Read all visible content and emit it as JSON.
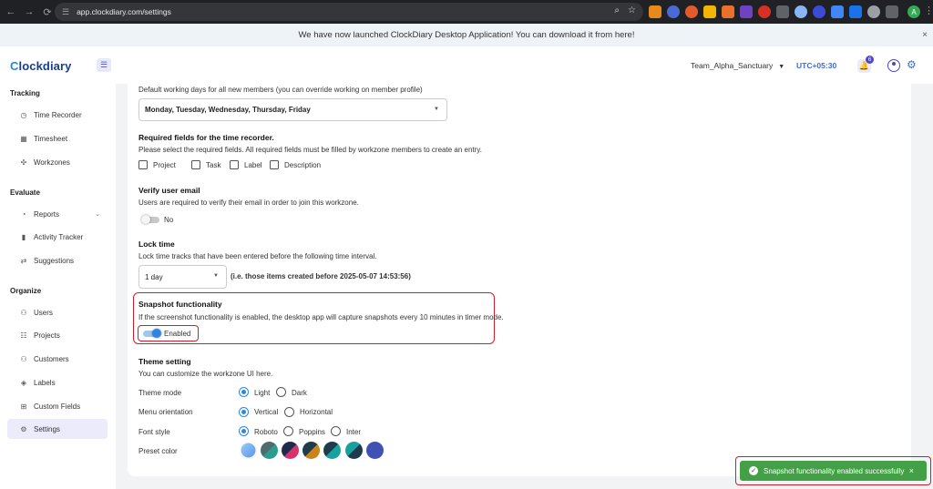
{
  "browser": {
    "url": "app.clockdiary.com/settings",
    "profile_initial": "A"
  },
  "announcement": {
    "text": "We have now launched ClockDiary Desktop Application! You can download it from here!",
    "close": "×"
  },
  "header": {
    "logo_first": "C",
    "logo_rest": "lockdiary",
    "workspace": "Team_Alpha_Sanctuary",
    "timezone": "UTC+05:30",
    "notification_count": "6"
  },
  "sidebar": {
    "sections": [
      {
        "title": "Tracking",
        "items": [
          {
            "label": "Time Recorder",
            "icon": "clock-icon"
          },
          {
            "label": "Timesheet",
            "icon": "calendar-icon"
          },
          {
            "label": "Workzones",
            "icon": "workzones-icon"
          }
        ]
      },
      {
        "title": "Evaluate",
        "items": [
          {
            "label": "Reports",
            "icon": "reports-icon"
          },
          {
            "label": "Activity Tracker",
            "icon": "activity-icon"
          },
          {
            "label": "Suggestions",
            "icon": "suggestions-icon"
          }
        ]
      },
      {
        "title": "Organize",
        "items": [
          {
            "label": "Users",
            "icon": "users-icon"
          },
          {
            "label": "Projects",
            "icon": "projects-icon"
          },
          {
            "label": "Customers",
            "icon": "customers-icon"
          },
          {
            "label": "Labels",
            "icon": "labels-icon"
          },
          {
            "label": "Custom Fields",
            "icon": "custom-fields-icon"
          },
          {
            "label": "Settings",
            "icon": "settings-icon",
            "active": true
          }
        ]
      }
    ]
  },
  "settings": {
    "working_days": {
      "description": "Default working days for all new members (you can override working on member profile)",
      "value": "Monday, Tuesday, Wednesday, Thursday, Friday"
    },
    "required_fields": {
      "title": "Required fields for the time recorder.",
      "description": "Please select the required fields. All required fields must be filled by workzone members to create an entry.",
      "options": [
        {
          "label": "Project",
          "checked": false
        },
        {
          "label": "Task",
          "checked": false
        },
        {
          "label": "Label",
          "checked": false
        },
        {
          "label": "Description",
          "checked": false
        }
      ]
    },
    "verify_email": {
      "title": "Verify user email",
      "description": "Users are required to verify their email in order to join this workzone.",
      "toggle_label": "No",
      "on": false
    },
    "lock_time": {
      "title": "Lock time",
      "description": "Lock time tracks that have been entered before the following time interval.",
      "value": "1 day",
      "note": "(i.e. those items created before 2025-05-07 14:53:56)"
    },
    "snapshot": {
      "title": "Snapshot functionality",
      "description": "If the screenshot functionality is enabled, the desktop app will capture snapshots every 10 minutes in timer mode.",
      "toggle_label": "Enabled",
      "on": true
    },
    "theme": {
      "title": "Theme setting",
      "description": "You can customize the workzone UI here.",
      "mode_label": "Theme mode",
      "mode_options": [
        "Light",
        "Dark"
      ],
      "mode_selected": "Light",
      "orientation_label": "Menu orientation",
      "orientation_options": [
        "Vertical",
        "Horizontal"
      ],
      "orientation_selected": "Vertical",
      "font_label": "Font style",
      "font_options": [
        "Roboto",
        "Poppins",
        "Inter"
      ],
      "font_selected": "Roboto",
      "preset_label": "Preset color",
      "preset_colors": [
        "#7ab6ef",
        "#2a9d8f",
        "#d6336c",
        "#c8841d",
        "#17a2a0",
        "#1f3c4d",
        "#3f51b5"
      ]
    }
  },
  "toast": {
    "message": "Snapshot functionality enabled successfully",
    "close": "×"
  },
  "colors": {
    "accent": "#3f6ad8",
    "highlight": "#d11d2b",
    "toast_bg": "#43a047",
    "toggle_on": "#2d86e6"
  }
}
